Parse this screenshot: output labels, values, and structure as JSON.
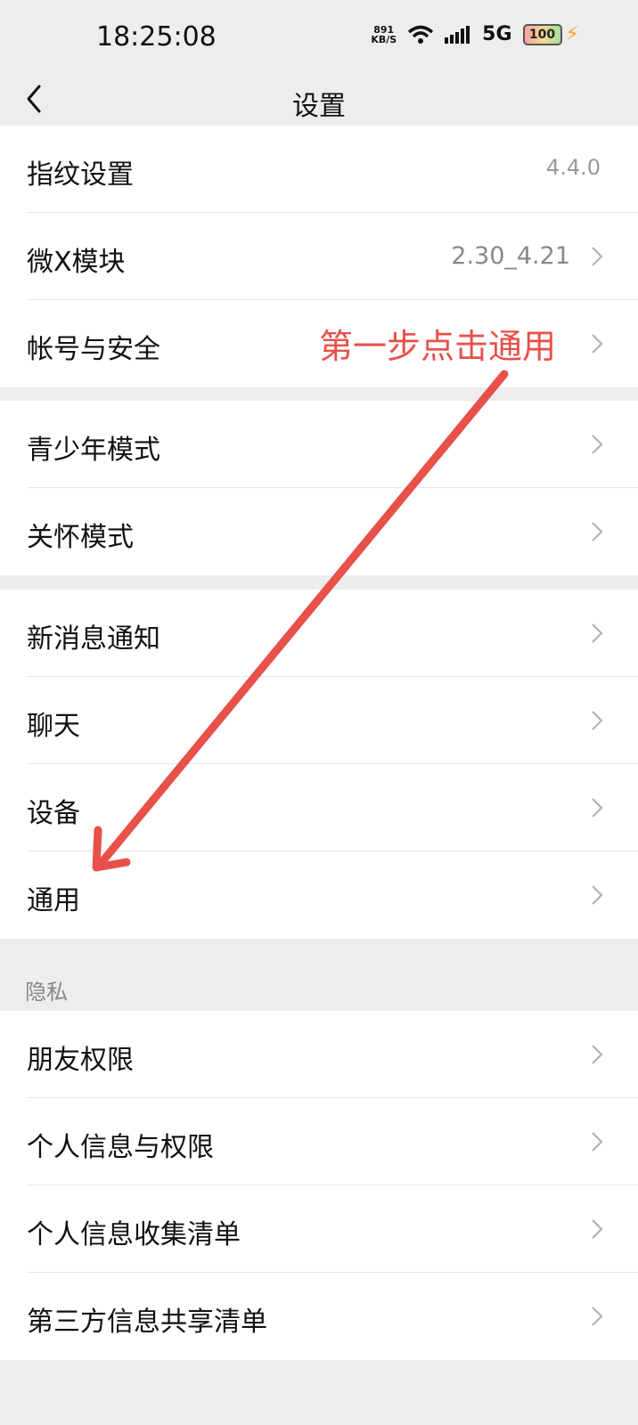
{
  "status_bar": {
    "time": "18:25:08",
    "net_speed": "891",
    "net_unit": "KB/S",
    "network_type": "5G",
    "battery": "100"
  },
  "nav": {
    "title": "设置"
  },
  "group1": [
    {
      "label": "指纹设置",
      "value": "4.4.0"
    },
    {
      "label": "微X模块",
      "value": "2.30_4.21"
    },
    {
      "label": "帐号与安全",
      "value": ""
    }
  ],
  "group2": [
    {
      "label": "青少年模式"
    },
    {
      "label": "关怀模式"
    }
  ],
  "group3": [
    {
      "label": "新消息通知"
    },
    {
      "label": "聊天"
    },
    {
      "label": "设备"
    },
    {
      "label": "通用"
    }
  ],
  "privacy": {
    "title": "隐私",
    "items": [
      {
        "label": "朋友权限"
      },
      {
        "label": "个人信息与权限"
      },
      {
        "label": "个人信息收集清单"
      },
      {
        "label": "第三方信息共享清单"
      }
    ]
  },
  "annotation": {
    "text": "第一步点击通用",
    "color": "#e8504a"
  }
}
